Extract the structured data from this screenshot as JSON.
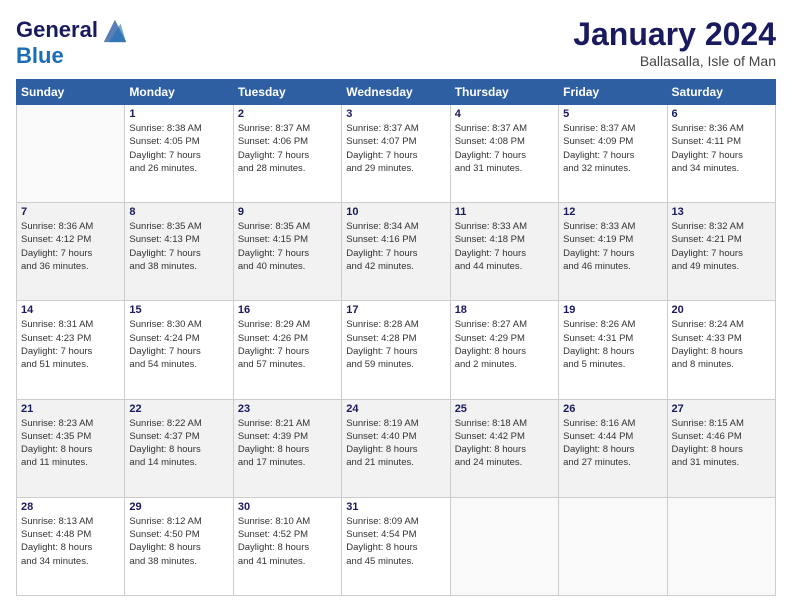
{
  "logo": {
    "line1": "General",
    "line2": "Blue"
  },
  "title": "January 2024",
  "location": "Ballasalla, Isle of Man",
  "days_header": [
    "Sunday",
    "Monday",
    "Tuesday",
    "Wednesday",
    "Thursday",
    "Friday",
    "Saturday"
  ],
  "weeks": [
    [
      {
        "day": "",
        "info": ""
      },
      {
        "day": "1",
        "info": "Sunrise: 8:38 AM\nSunset: 4:05 PM\nDaylight: 7 hours\nand 26 minutes."
      },
      {
        "day": "2",
        "info": "Sunrise: 8:37 AM\nSunset: 4:06 PM\nDaylight: 7 hours\nand 28 minutes."
      },
      {
        "day": "3",
        "info": "Sunrise: 8:37 AM\nSunset: 4:07 PM\nDaylight: 7 hours\nand 29 minutes."
      },
      {
        "day": "4",
        "info": "Sunrise: 8:37 AM\nSunset: 4:08 PM\nDaylight: 7 hours\nand 31 minutes."
      },
      {
        "day": "5",
        "info": "Sunrise: 8:37 AM\nSunset: 4:09 PM\nDaylight: 7 hours\nand 32 minutes."
      },
      {
        "day": "6",
        "info": "Sunrise: 8:36 AM\nSunset: 4:11 PM\nDaylight: 7 hours\nand 34 minutes."
      }
    ],
    [
      {
        "day": "7",
        "info": "Sunrise: 8:36 AM\nSunset: 4:12 PM\nDaylight: 7 hours\nand 36 minutes."
      },
      {
        "day": "8",
        "info": "Sunrise: 8:35 AM\nSunset: 4:13 PM\nDaylight: 7 hours\nand 38 minutes."
      },
      {
        "day": "9",
        "info": "Sunrise: 8:35 AM\nSunset: 4:15 PM\nDaylight: 7 hours\nand 40 minutes."
      },
      {
        "day": "10",
        "info": "Sunrise: 8:34 AM\nSunset: 4:16 PM\nDaylight: 7 hours\nand 42 minutes."
      },
      {
        "day": "11",
        "info": "Sunrise: 8:33 AM\nSunset: 4:18 PM\nDaylight: 7 hours\nand 44 minutes."
      },
      {
        "day": "12",
        "info": "Sunrise: 8:33 AM\nSunset: 4:19 PM\nDaylight: 7 hours\nand 46 minutes."
      },
      {
        "day": "13",
        "info": "Sunrise: 8:32 AM\nSunset: 4:21 PM\nDaylight: 7 hours\nand 49 minutes."
      }
    ],
    [
      {
        "day": "14",
        "info": "Sunrise: 8:31 AM\nSunset: 4:23 PM\nDaylight: 7 hours\nand 51 minutes."
      },
      {
        "day": "15",
        "info": "Sunrise: 8:30 AM\nSunset: 4:24 PM\nDaylight: 7 hours\nand 54 minutes."
      },
      {
        "day": "16",
        "info": "Sunrise: 8:29 AM\nSunset: 4:26 PM\nDaylight: 7 hours\nand 57 minutes."
      },
      {
        "day": "17",
        "info": "Sunrise: 8:28 AM\nSunset: 4:28 PM\nDaylight: 7 hours\nand 59 minutes."
      },
      {
        "day": "18",
        "info": "Sunrise: 8:27 AM\nSunset: 4:29 PM\nDaylight: 8 hours\nand 2 minutes."
      },
      {
        "day": "19",
        "info": "Sunrise: 8:26 AM\nSunset: 4:31 PM\nDaylight: 8 hours\nand 5 minutes."
      },
      {
        "day": "20",
        "info": "Sunrise: 8:24 AM\nSunset: 4:33 PM\nDaylight: 8 hours\nand 8 minutes."
      }
    ],
    [
      {
        "day": "21",
        "info": "Sunrise: 8:23 AM\nSunset: 4:35 PM\nDaylight: 8 hours\nand 11 minutes."
      },
      {
        "day": "22",
        "info": "Sunrise: 8:22 AM\nSunset: 4:37 PM\nDaylight: 8 hours\nand 14 minutes."
      },
      {
        "day": "23",
        "info": "Sunrise: 8:21 AM\nSunset: 4:39 PM\nDaylight: 8 hours\nand 17 minutes."
      },
      {
        "day": "24",
        "info": "Sunrise: 8:19 AM\nSunset: 4:40 PM\nDaylight: 8 hours\nand 21 minutes."
      },
      {
        "day": "25",
        "info": "Sunrise: 8:18 AM\nSunset: 4:42 PM\nDaylight: 8 hours\nand 24 minutes."
      },
      {
        "day": "26",
        "info": "Sunrise: 8:16 AM\nSunset: 4:44 PM\nDaylight: 8 hours\nand 27 minutes."
      },
      {
        "day": "27",
        "info": "Sunrise: 8:15 AM\nSunset: 4:46 PM\nDaylight: 8 hours\nand 31 minutes."
      }
    ],
    [
      {
        "day": "28",
        "info": "Sunrise: 8:13 AM\nSunset: 4:48 PM\nDaylight: 8 hours\nand 34 minutes."
      },
      {
        "day": "29",
        "info": "Sunrise: 8:12 AM\nSunset: 4:50 PM\nDaylight: 8 hours\nand 38 minutes."
      },
      {
        "day": "30",
        "info": "Sunrise: 8:10 AM\nSunset: 4:52 PM\nDaylight: 8 hours\nand 41 minutes."
      },
      {
        "day": "31",
        "info": "Sunrise: 8:09 AM\nSunset: 4:54 PM\nDaylight: 8 hours\nand 45 minutes."
      },
      {
        "day": "",
        "info": ""
      },
      {
        "day": "",
        "info": ""
      },
      {
        "day": "",
        "info": ""
      }
    ]
  ]
}
